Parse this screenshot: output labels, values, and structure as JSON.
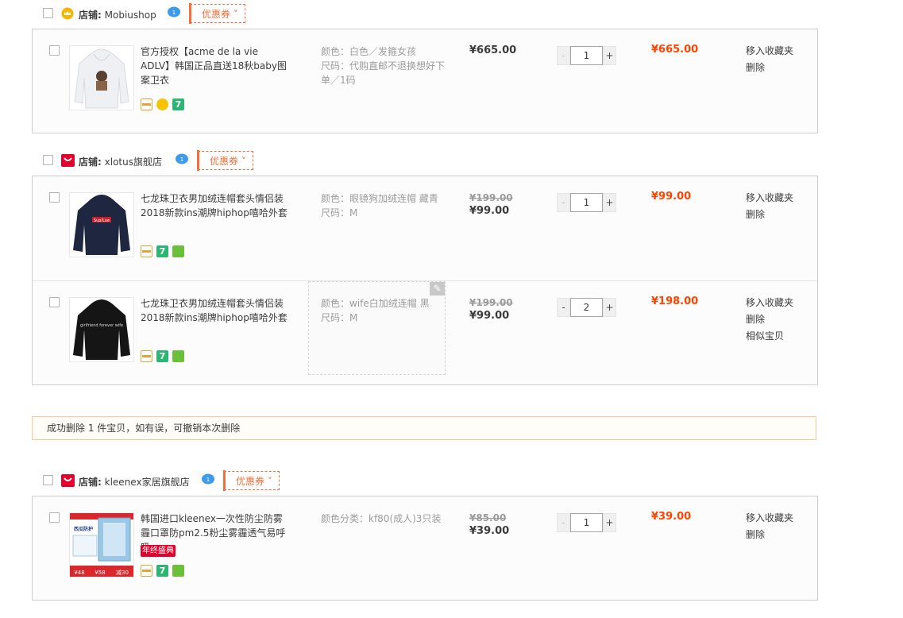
{
  "coupon_label": "优惠券 ˅",
  "shop_prefix": "店铺:",
  "shops": [
    {
      "name": "Mobiushop",
      "items": [
        {
          "title": "官方授权【acme de la vie ADLV】韩国正品直送18秋baby图案卫衣",
          "sku_lines": [
            "颜色：白色／发箍女孩",
            "尺码：代购直邮不退换想好下单／1码"
          ],
          "old_price": "",
          "price": "¥665.00",
          "qty": "1",
          "subtotal": "¥665.00",
          "ops": [
            "移入收藏夹",
            "删除"
          ]
        }
      ]
    },
    {
      "name": "xlotus旗舰店",
      "items": [
        {
          "title": "七龙珠卫衣男加绒连帽套头情侣装2018新款ins潮牌hiphop嘻哈外套",
          "sku_lines": [
            "颜色：眼镜狗加绒连帽 藏青",
            "尺码：M"
          ],
          "old_price": "¥199.00",
          "price": "¥99.00",
          "qty": "1",
          "subtotal": "¥99.00",
          "ops": [
            "移入收藏夹",
            "删除"
          ]
        },
        {
          "title": "七龙珠卫衣男加绒连帽套头情侣装2018新款ins潮牌hiphop嘻哈外套",
          "sku_lines": [
            "颜色：wife白加绒连帽 黑",
            "尺码：M"
          ],
          "old_price": "¥199.00",
          "price": "¥99.00",
          "qty": "2",
          "subtotal": "¥198.00",
          "ops": [
            "移入收藏夹",
            "删除",
            "相似宝贝"
          ]
        }
      ]
    },
    {
      "name": "kleenex家居旗舰店",
      "items": [
        {
          "title": "韩国进口kleenex一次性防尘防雾霾口罩防pm2.5粉尘雾霾透气易呼吸",
          "sku_lines": [
            "颜色分类：kf80(成人)3只装"
          ],
          "old_price": "¥85.00",
          "price": "¥39.00",
          "qty": "1",
          "subtotal": "¥39.00",
          "ops": [
            "移入收藏夹",
            "删除"
          ],
          "promo_tag": "年终盛典"
        }
      ]
    }
  ],
  "product_images": {
    "item_0_shirt_text": "",
    "item_1_shirt_text": "Sup/Lue",
    "item_2_shirt_text": "girlfriend forever wife",
    "item_3_banner": "西瓜防护",
    "item_3_prices": [
      "¥48",
      "¥58",
      "减30"
    ]
  },
  "notice": "成功删除 1 件宝贝，如有误，可撤销本次删除",
  "qty_minus": "-",
  "qty_plus": "+",
  "colors": {
    "accent": "#f40",
    "coupon": "#f1703c",
    "border": "#cdcdcd"
  },
  "icons": [
    "shop-crown-icon",
    "tmall-icon",
    "wangwang-chat-icon",
    "credit-card-icon",
    "seven-day-return-icon",
    "certified-icon",
    "edit-pencil-icon"
  ]
}
